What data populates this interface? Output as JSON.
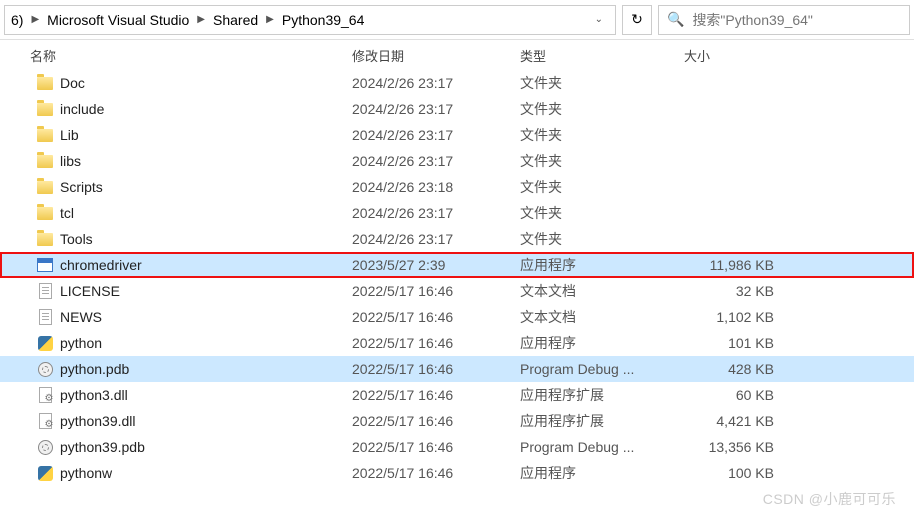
{
  "breadcrumb": {
    "root_partial": "6)",
    "segments": [
      "Microsoft Visual Studio",
      "Shared",
      "Python39_64"
    ]
  },
  "search": {
    "placeholder": "搜索\"Python39_64\""
  },
  "columns": {
    "name": "名称",
    "date": "修改日期",
    "type": "类型",
    "size": "大小"
  },
  "files": [
    {
      "icon": "folder",
      "name": "Doc",
      "date": "2024/2/26 23:17",
      "type": "文件夹",
      "size": "",
      "state": ""
    },
    {
      "icon": "folder",
      "name": "include",
      "date": "2024/2/26 23:17",
      "type": "文件夹",
      "size": "",
      "state": ""
    },
    {
      "icon": "folder",
      "name": "Lib",
      "date": "2024/2/26 23:17",
      "type": "文件夹",
      "size": "",
      "state": ""
    },
    {
      "icon": "folder",
      "name": "libs",
      "date": "2024/2/26 23:17",
      "type": "文件夹",
      "size": "",
      "state": ""
    },
    {
      "icon": "folder",
      "name": "Scripts",
      "date": "2024/2/26 23:18",
      "type": "文件夹",
      "size": "",
      "state": ""
    },
    {
      "icon": "folder",
      "name": "tcl",
      "date": "2024/2/26 23:17",
      "type": "文件夹",
      "size": "",
      "state": ""
    },
    {
      "icon": "folder",
      "name": "Tools",
      "date": "2024/2/26 23:17",
      "type": "文件夹",
      "size": "",
      "state": ""
    },
    {
      "icon": "exe",
      "name": "chromedriver",
      "date": "2023/5/27 2:39",
      "type": "应用程序",
      "size": "11,986 KB",
      "state": "highlighted"
    },
    {
      "icon": "txt",
      "name": "LICENSE",
      "date": "2022/5/17 16:46",
      "type": "文本文档",
      "size": "32 KB",
      "state": ""
    },
    {
      "icon": "txt",
      "name": "NEWS",
      "date": "2022/5/17 16:46",
      "type": "文本文档",
      "size": "1,102 KB",
      "state": ""
    },
    {
      "icon": "py",
      "name": "python",
      "date": "2022/5/17 16:46",
      "type": "应用程序",
      "size": "101 KB",
      "state": ""
    },
    {
      "icon": "pdb",
      "name": "python.pdb",
      "date": "2022/5/17 16:46",
      "type": "Program Debug ...",
      "size": "428 KB",
      "state": "selected"
    },
    {
      "icon": "dll",
      "name": "python3.dll",
      "date": "2022/5/17 16:46",
      "type": "应用程序扩展",
      "size": "60 KB",
      "state": ""
    },
    {
      "icon": "dll",
      "name": "python39.dll",
      "date": "2022/5/17 16:46",
      "type": "应用程序扩展",
      "size": "4,421 KB",
      "state": ""
    },
    {
      "icon": "pdb",
      "name": "python39.pdb",
      "date": "2022/5/17 16:46",
      "type": "Program Debug ...",
      "size": "13,356 KB",
      "state": ""
    },
    {
      "icon": "py",
      "name": "pythonw",
      "date": "2022/5/17 16:46",
      "type": "应用程序",
      "size": "100 KB",
      "state": ""
    }
  ],
  "watermark": "CSDN @小鹿可可乐"
}
